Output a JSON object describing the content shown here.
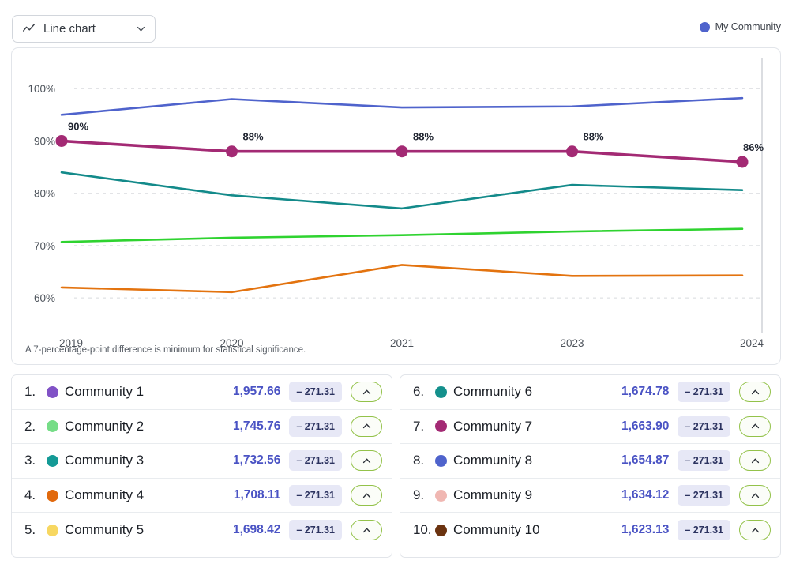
{
  "toolbar": {
    "chart_type_label": "Line chart",
    "chart_type_icon": "line-chart-icon",
    "chevron_icon": "chevron-down-icon"
  },
  "legend": {
    "label": "My Community",
    "color": "#4f63cc"
  },
  "footnote": "A 7-percentage-point difference is minimum for statistical significance.",
  "chart_data": {
    "type": "line",
    "title": "",
    "xlabel": "",
    "ylabel": "",
    "x": [
      "2019",
      "2020",
      "2021",
      "2023",
      "2024"
    ],
    "ylim": [
      57,
      102
    ],
    "yticks": [
      60,
      70,
      80,
      90,
      100
    ],
    "ytick_labels": [
      "60%",
      "70%",
      "80%",
      "90%",
      "100%"
    ],
    "grid": true,
    "legend_position": "top-right",
    "highlight_series": "Community 7",
    "point_labels": [
      "90%",
      "88%",
      "88%",
      "88%",
      "86%"
    ],
    "series": [
      {
        "name": "Community 8",
        "color": "#4f63cc",
        "values": [
          95.0,
          98.0,
          96.4,
          96.6,
          98.2
        ],
        "highlighted": false
      },
      {
        "name": "Community 7",
        "color": "#a32a74",
        "values": [
          90.0,
          88.0,
          88.0,
          88.0,
          86.0
        ],
        "highlighted": true
      },
      {
        "name": "Community 6",
        "color": "#138a8a",
        "values": [
          84.0,
          79.6,
          77.1,
          81.6,
          80.6
        ],
        "highlighted": false
      },
      {
        "name": "Community 2",
        "color": "#2fd330",
        "values": [
          70.7,
          71.5,
          72.0,
          72.7,
          73.2
        ],
        "highlighted": false
      },
      {
        "name": "Community 4",
        "color": "#e3730f",
        "values": [
          62.0,
          61.1,
          66.3,
          64.2,
          64.3
        ],
        "highlighted": false
      }
    ]
  },
  "lists": [
    {
      "name": "leaderboard-left",
      "rows": [
        {
          "rank": "1.",
          "name": "Community 1",
          "color": "#8152c6",
          "value": "1,957.66",
          "delta": "– 271.31",
          "trend_icon": "chevron-up-icon"
        },
        {
          "rank": "2.",
          "name": "Community 2",
          "color": "#76dd87",
          "value": "1,745.76",
          "delta": "– 271.31",
          "trend_icon": "chevron-up-icon"
        },
        {
          "rank": "3.",
          "name": "Community 3",
          "color": "#149a96",
          "value": "1,732.56",
          "delta": "– 271.31",
          "trend_icon": "chevron-up-icon"
        },
        {
          "rank": "4.",
          "name": "Community 4",
          "color": "#e1690d",
          "value": "1,708.11",
          "delta": "– 271.31",
          "trend_icon": "chevron-up-icon"
        },
        {
          "rank": "5.",
          "name": "Community 5",
          "color": "#f7d761",
          "value": "1,698.42",
          "delta": "– 271.31",
          "trend_icon": "chevron-up-icon"
        }
      ]
    },
    {
      "name": "leaderboard-right",
      "rows": [
        {
          "rank": "6.",
          "name": "Community 6",
          "color": "#14908c",
          "value": "1,674.78",
          "delta": "– 271.31",
          "trend_icon": "chevron-up-icon"
        },
        {
          "rank": "7.",
          "name": "Community 7",
          "color": "#a32a74",
          "value": "1,663.90",
          "delta": "– 271.31",
          "trend_icon": "chevron-up-icon"
        },
        {
          "rank": "8.",
          "name": "Community 8",
          "color": "#4f63cc",
          "value": "1,654.87",
          "delta": "– 271.31",
          "trend_icon": "chevron-up-icon"
        },
        {
          "rank": "9.",
          "name": "Community 9",
          "color": "#f0b7b2",
          "value": "1,634.12",
          "delta": "– 271.31",
          "trend_icon": "chevron-up-icon"
        },
        {
          "rank": "10.",
          "name": "Community 10",
          "color": "#6b3310",
          "value": "1,623.13",
          "delta": "– 271.31",
          "trend_icon": "chevron-up-icon"
        }
      ]
    }
  ]
}
